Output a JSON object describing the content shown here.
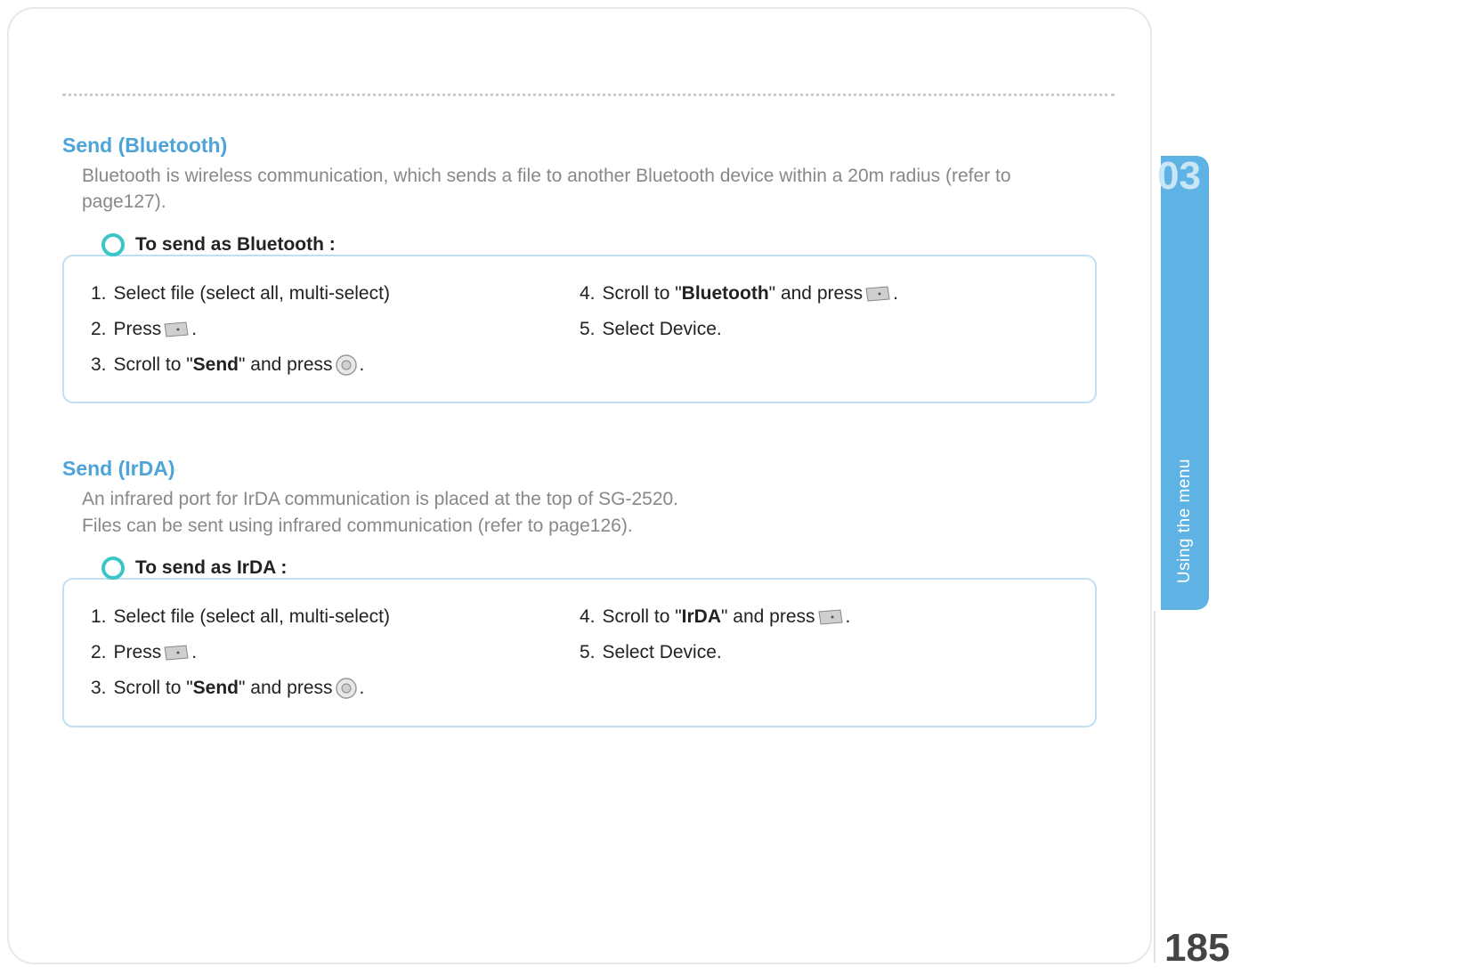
{
  "sideTab": {
    "chapter": "03",
    "label": "Using the menu"
  },
  "pageNumber": "185",
  "sections": {
    "bluetooth": {
      "title": "Send (Bluetooth)",
      "desc": "Bluetooth is wireless communication, which sends a file to another Bluetooth device within a 20m radius (refer to page127).",
      "callout": "To send as Bluetooth :",
      "left": {
        "s1": {
          "n": "1.",
          "t": "Select file (select all, multi-select)"
        },
        "s2": {
          "n": "2.",
          "pre": "Press ",
          "post": "."
        },
        "s3": {
          "n": "3.",
          "pre": "Scroll to \"",
          "bold": "Send",
          "mid": "\" and press ",
          "post": "."
        }
      },
      "right": {
        "s4": {
          "n": "4.",
          "pre": "Scroll to \"",
          "bold": "Bluetooth",
          "mid": "\" and press ",
          "post": "."
        },
        "s5": {
          "n": "5.",
          "t": "Select Device."
        }
      }
    },
    "irda": {
      "title": "Send (IrDA)",
      "desc1": "An infrared port for IrDA communication is placed at the top of SG-2520.",
      "desc2": "Files can be sent using infrared communication (refer to page126).",
      "callout": "To send as IrDA :",
      "left": {
        "s1": {
          "n": "1.",
          "t": "Select file (select all, multi-select)"
        },
        "s2": {
          "n": "2.",
          "pre": "Press ",
          "post": "."
        },
        "s3": {
          "n": "3.",
          "pre": "Scroll to \"",
          "bold": "Send",
          "mid": "\" and press ",
          "post": "."
        }
      },
      "right": {
        "s4": {
          "n": "4.",
          "pre": "Scroll to \"",
          "bold": "IrDA",
          "mid": "\" and press ",
          "post": "."
        },
        "s5": {
          "n": "5.",
          "t": "Select Device."
        }
      }
    }
  }
}
